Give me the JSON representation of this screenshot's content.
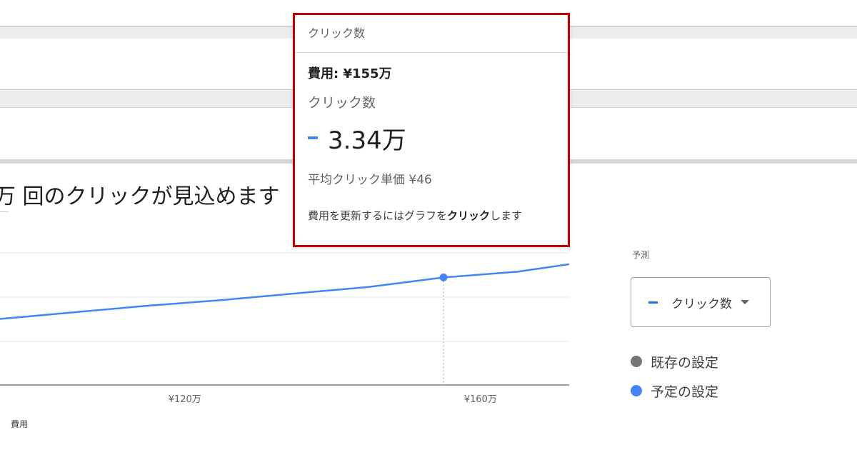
{
  "headline": {
    "prefix_glyph": "万",
    "text": "回のクリックが見込めます"
  },
  "tooltip": {
    "header": "クリック数",
    "cost": "費用: ¥155万",
    "metric_label": "クリック数",
    "metric_value": "3.34万",
    "cpc": "平均クリック単価 ¥46",
    "hint_prefix": "費用を更新するにはグラフを",
    "hint_bold": "クリック",
    "hint_suffix": "します",
    "series_color": "#4285f4"
  },
  "forecast": {
    "label": "予測",
    "metric_select": {
      "selected": "クリック数",
      "icon": "chevron-down-icon"
    },
    "legend": [
      {
        "label": "既存の設定",
        "color": "#757575"
      },
      {
        "label": "予定の設定",
        "color": "#4285f4"
      }
    ]
  },
  "chart_data": {
    "type": "line",
    "xlabel": "費用",
    "x_ticks": [
      "¥120万",
      "¥160万"
    ],
    "series": [
      {
        "color": "#4285f4",
        "x": [
          95,
          105,
          115,
          125,
          135,
          145,
          155,
          165,
          172
        ],
        "y": [
          2.9,
          2.97,
          3.04,
          3.1,
          3.17,
          3.24,
          3.34,
          3.4,
          3.48
        ]
      }
    ],
    "highlight": {
      "x": 155,
      "y": 3.34
    },
    "xlim": [
      95,
      172
    ],
    "ylim": [
      2.2,
      3.6
    ],
    "grid": true
  }
}
